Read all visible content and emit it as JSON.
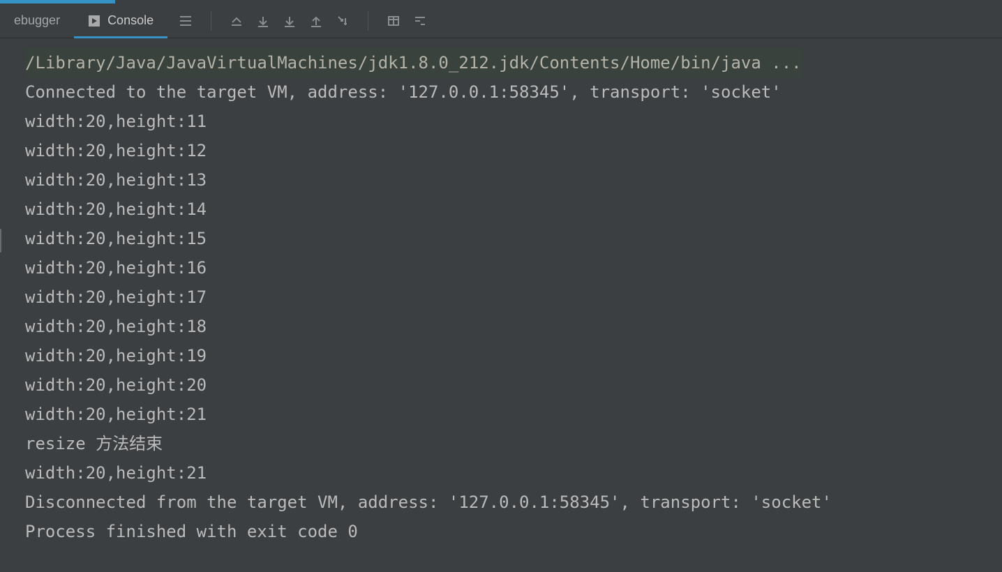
{
  "tabs": {
    "debugger": {
      "label": "ebugger"
    },
    "console": {
      "label": "Console"
    }
  },
  "console": {
    "command_line": "/Library/Java/JavaVirtualMachines/jdk1.8.0_212.jdk/Contents/Home/bin/java ...",
    "lines": [
      "Connected to the target VM, address: '127.0.0.1:58345', transport: 'socket'",
      "width:20,height:11",
      "width:20,height:12",
      "width:20,height:13",
      "width:20,height:14",
      "width:20,height:15",
      "width:20,height:16",
      "width:20,height:17",
      "width:20,height:18",
      "width:20,height:19",
      "width:20,height:20",
      "width:20,height:21",
      "resize 方法结束",
      "width:20,height:21",
      "Disconnected from the target VM, address: '127.0.0.1:58345', transport: 'socket'",
      "",
      "Process finished with exit code 0"
    ]
  }
}
